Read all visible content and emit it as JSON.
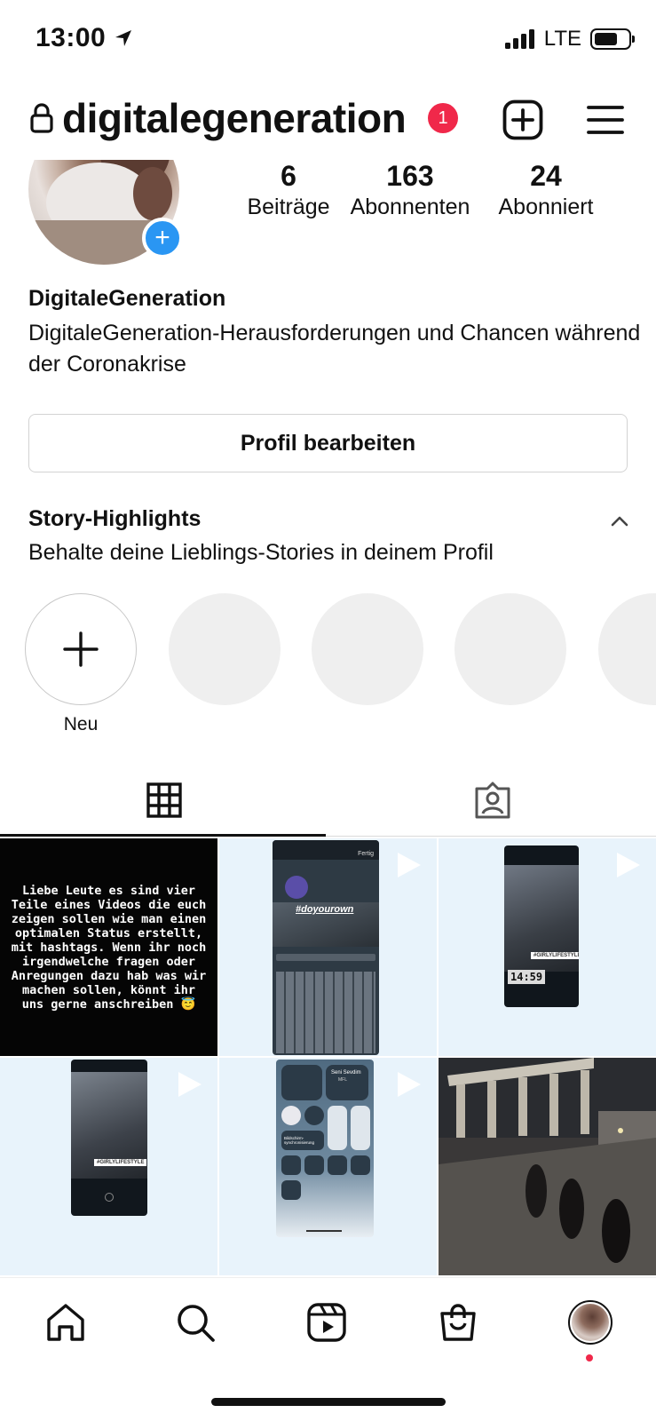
{
  "status_bar": {
    "time": "13:00",
    "network": "LTE"
  },
  "header": {
    "username": "digitalegeneration",
    "notification_count": "1"
  },
  "profile": {
    "stats": [
      {
        "value": "6",
        "label": "Beiträge"
      },
      {
        "value": "163",
        "label": "Abonnenten"
      },
      {
        "value": "24",
        "label": "Abonniert"
      }
    ],
    "display_name": "DigitaleGeneration",
    "bio": "DigitaleGeneration-Herausforderungen und Chancen während der Coronakrise",
    "edit_button": "Profil bearbeiten"
  },
  "highlights": {
    "title": "Story-Highlights",
    "subtitle": "Behalte deine Lieblings-Stories in deinem Profil",
    "new_label": "Neu"
  },
  "posts": {
    "text_post": "Liebe Leute es sind vier Teile eines Videos die euch zeigen sollen wie man einen optimalen Status erstellt, mit hashtags. Wenn ihr noch irgendwelche fragen oder Anregungen dazu hab was wir machen sollen, könnt ihr uns gerne anschreiben 😇",
    "hashtag_overlay": "#doyourown",
    "sticker_text": "#GIRLYLIFESTYLE",
    "sticker_time": "14:59",
    "music_title": "Seni Sevdim",
    "music_artist": "MFL",
    "cc_label": "Bildschirm-synchronisierung",
    "done_label": "Fertig"
  },
  "colors": {
    "accent": "#2a96f3",
    "badge": "#f0284a",
    "tile_bg": "#e8f3fb"
  }
}
